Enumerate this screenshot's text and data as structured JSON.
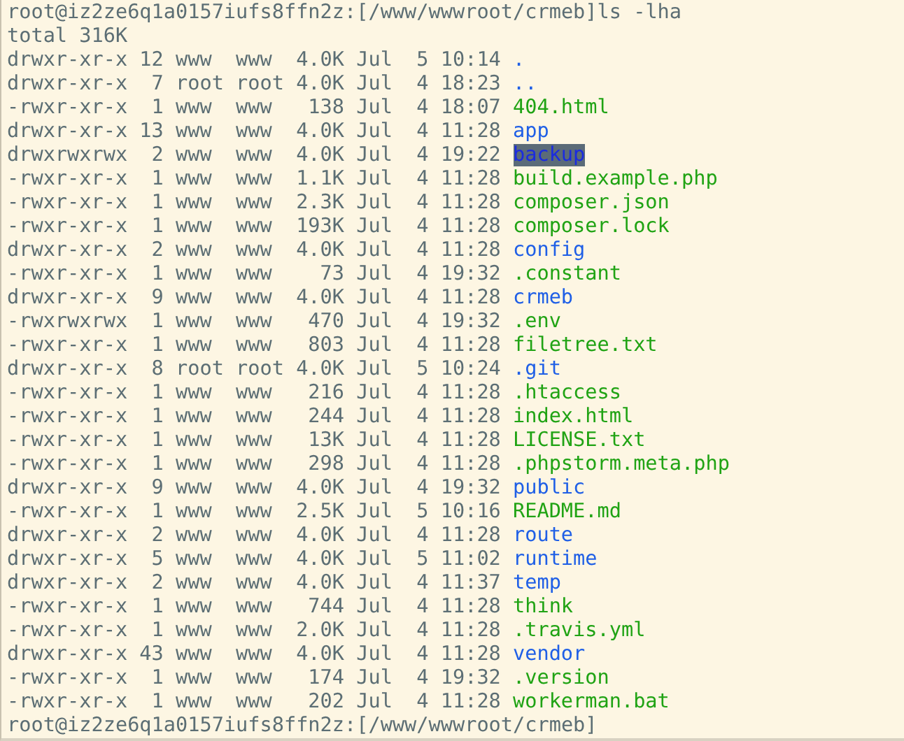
{
  "prompt": {
    "text": "root@iz2ze6q1a0157iufs8ffn2z:[/www/wwwroot/crmeb]",
    "command": "ls -lha"
  },
  "total": "total 316K",
  "entries": [
    {
      "meta": "drwxr-xr-x 12 www  www  4.0K Jul  5 10:14",
      "name": ".",
      "kind": "dir",
      "selected": false
    },
    {
      "meta": "drwxr-xr-x  7 root root 4.0K Jul  4 18:23",
      "name": "..",
      "kind": "dir",
      "selected": false
    },
    {
      "meta": "-rwxr-xr-x  1 www  www   138 Jul  4 18:07",
      "name": "404.html",
      "kind": "file",
      "selected": false
    },
    {
      "meta": "drwxr-xr-x 13 www  www  4.0K Jul  4 11:28",
      "name": "app",
      "kind": "dir",
      "selected": false
    },
    {
      "meta": "drwxrwxrwx  2 www  www  4.0K Jul  4 19:22",
      "name": "backup",
      "kind": "dir",
      "selected": true
    },
    {
      "meta": "-rwxr-xr-x  1 www  www  1.1K Jul  4 11:28",
      "name": "build.example.php",
      "kind": "file",
      "selected": false
    },
    {
      "meta": "-rwxr-xr-x  1 www  www  2.3K Jul  4 11:28",
      "name": "composer.json",
      "kind": "file",
      "selected": false
    },
    {
      "meta": "-rwxr-xr-x  1 www  www  193K Jul  4 11:28",
      "name": "composer.lock",
      "kind": "file",
      "selected": false
    },
    {
      "meta": "drwxr-xr-x  2 www  www  4.0K Jul  4 11:28",
      "name": "config",
      "kind": "dir",
      "selected": false
    },
    {
      "meta": "-rwxr-xr-x  1 www  www    73 Jul  4 19:32",
      "name": ".constant",
      "kind": "file",
      "selected": false
    },
    {
      "meta": "drwxr-xr-x  9 www  www  4.0K Jul  4 11:28",
      "name": "crmeb",
      "kind": "dir",
      "selected": false
    },
    {
      "meta": "-rwxrwxrwx  1 www  www   470 Jul  4 19:32",
      "name": ".env",
      "kind": "file",
      "selected": false
    },
    {
      "meta": "-rwxr-xr-x  1 www  www   803 Jul  4 11:28",
      "name": "filetree.txt",
      "kind": "file",
      "selected": false
    },
    {
      "meta": "drwxr-xr-x  8 root root 4.0K Jul  5 10:24",
      "name": ".git",
      "kind": "dir",
      "selected": false
    },
    {
      "meta": "-rwxr-xr-x  1 www  www   216 Jul  4 11:28",
      "name": ".htaccess",
      "kind": "file",
      "selected": false
    },
    {
      "meta": "-rwxr-xr-x  1 www  www   244 Jul  4 11:28",
      "name": "index.html",
      "kind": "file",
      "selected": false
    },
    {
      "meta": "-rwxr-xr-x  1 www  www   13K Jul  4 11:28",
      "name": "LICENSE.txt",
      "kind": "file",
      "selected": false
    },
    {
      "meta": "-rwxr-xr-x  1 www  www   298 Jul  4 11:28",
      "name": ".phpstorm.meta.php",
      "kind": "file",
      "selected": false
    },
    {
      "meta": "drwxr-xr-x  9 www  www  4.0K Jul  4 19:32",
      "name": "public",
      "kind": "dir",
      "selected": false
    },
    {
      "meta": "-rwxr-xr-x  1 www  www  2.5K Jul  5 10:16",
      "name": "README.md",
      "kind": "file",
      "selected": false
    },
    {
      "meta": "drwxr-xr-x  2 www  www  4.0K Jul  4 11:28",
      "name": "route",
      "kind": "dir",
      "selected": false
    },
    {
      "meta": "drwxr-xr-x  5 www  www  4.0K Jul  5 11:02",
      "name": "runtime",
      "kind": "dir",
      "selected": false
    },
    {
      "meta": "drwxr-xr-x  2 www  www  4.0K Jul  4 11:37",
      "name": "temp",
      "kind": "dir",
      "selected": false
    },
    {
      "meta": "-rwxr-xr-x  1 www  www   744 Jul  4 11:28",
      "name": "think",
      "kind": "file",
      "selected": false
    },
    {
      "meta": "-rwxr-xr-x  1 www  www  2.0K Jul  4 11:28",
      "name": ".travis.yml",
      "kind": "file",
      "selected": false
    },
    {
      "meta": "drwxr-xr-x 43 www  www  4.0K Jul  4 11:28",
      "name": "vendor",
      "kind": "dir",
      "selected": false
    },
    {
      "meta": "-rwxr-xr-x  1 www  www   174 Jul  4 19:32",
      "name": ".version",
      "kind": "file",
      "selected": false
    },
    {
      "meta": "-rwxr-xr-x  1 www  www   202 Jul  4 11:28",
      "name": "workerman.bat",
      "kind": "file",
      "selected": false
    }
  ],
  "end_prompt": {
    "text": "root@iz2ze6q1a0157iufs8ffn2z:[/www/wwwroot/crmeb]"
  }
}
